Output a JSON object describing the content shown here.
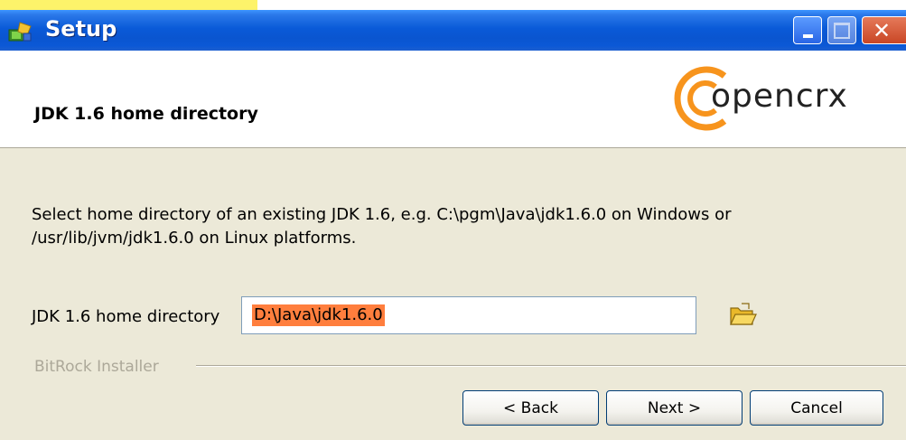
{
  "window": {
    "title": "Setup",
    "controls": {
      "minimize": "minimize",
      "maximize": "maximize",
      "close": "close"
    }
  },
  "header": {
    "heading": "JDK 1.6 home directory",
    "logo_text": "opencrx"
  },
  "main": {
    "description": "Select home directory of an existing JDK 1.6, e.g. C:\\pgm\\Java\\jdk1.6.0 on Windows or /usr/lib/jvm/jdk1.6.0 on Linux platforms.",
    "field_label": "JDK 1.6 home directory",
    "field_value": "D:\\Java\\jdk1.6.0"
  },
  "footer": {
    "installer_label": "BitRock Installer",
    "back_label": "< Back",
    "next_label": "Next >",
    "cancel_label": "Cancel"
  },
  "colors": {
    "titlebar": "#0a55d0",
    "window_bg": "#ece9d8",
    "selection_highlight": "#ff7e3d",
    "logo_accent": "#f7941d"
  }
}
